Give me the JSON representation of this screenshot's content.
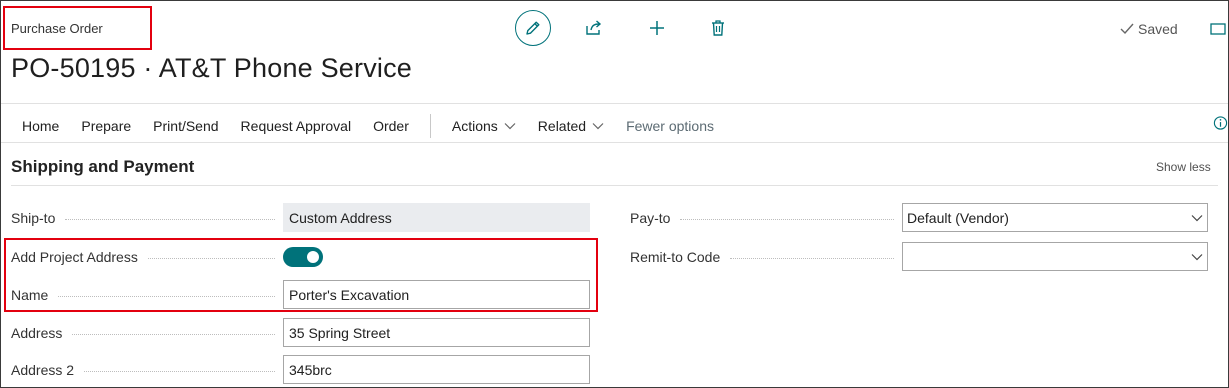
{
  "header": {
    "breadcrumb": "Purchase Order",
    "title": "PO-50195 · AT&T Phone Service",
    "status": "Saved",
    "toolbar": {
      "edit_icon": "pencil-icon",
      "share_icon": "share-icon",
      "new_icon": "plus-icon",
      "delete_icon": "trash-icon",
      "status_icon": "checkmark-icon",
      "overflow_icon": "open-window-icon"
    }
  },
  "menu": {
    "items": [
      "Home",
      "Prepare",
      "Print/Send",
      "Request Approval",
      "Order"
    ],
    "actions": "Actions",
    "related": "Related",
    "fewer": "Fewer options",
    "info_icon": "info-icon"
  },
  "section": {
    "title": "Shipping and Payment",
    "toggle_label": "Show less"
  },
  "fields": {
    "ship_to": {
      "label": "Ship-to",
      "value": "Custom Address"
    },
    "add_project_address": {
      "label": "Add Project Address",
      "value": "on"
    },
    "name": {
      "label": "Name",
      "value": "Porter's Excavation"
    },
    "address": {
      "label": "Address",
      "value": "35 Spring Street"
    },
    "address2": {
      "label": "Address 2",
      "value": "345brc"
    },
    "pay_to": {
      "label": "Pay-to",
      "value": "Default (Vendor)"
    },
    "remit_to": {
      "label": "Remit-to Code",
      "value": ""
    }
  },
  "colors": {
    "accent": "#00727a",
    "highlight": "#e3000f"
  }
}
